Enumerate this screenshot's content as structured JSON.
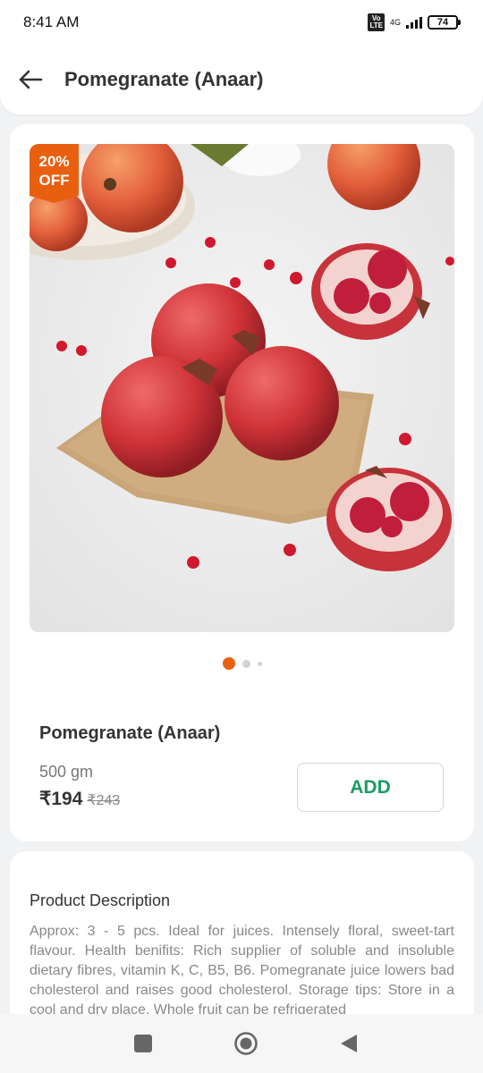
{
  "status_bar": {
    "time": "8:41 AM",
    "volte_label": "Vo\nLTE",
    "network_label": "4G",
    "battery": "74"
  },
  "header": {
    "title": "Pomegranate (Anaar)",
    "back_icon": "arrow-left-icon"
  },
  "product": {
    "discount_badge": "20%\nOFF",
    "image_count": 3,
    "active_image_index": 0,
    "name": "Pomegranate (Anaar)",
    "quantity": "500 gm",
    "price": "₹194",
    "mrp": "₹243",
    "add_label": "ADD"
  },
  "description": {
    "title": "Product Description",
    "text": "Approx: 3 - 5 pcs. Ideal for juices. Intensely floral, sweet-tart flavour. Health benifits: Rich supplier of soluble and insoluble dietary fibres, vitamin K, C, B5, B6. Pomegranate juice lowers bad cholesterol and raises good cholesterol. Storage tips: Store in a cool and dry place. Whole fruit can be refrigerated"
  },
  "nav_bar": {
    "items": [
      "recents-icon",
      "home-icon",
      "back-icon"
    ]
  },
  "colors": {
    "accent_orange": "#e8600f",
    "add_green": "#1a9c66",
    "fruit_red": "#c8323a"
  }
}
